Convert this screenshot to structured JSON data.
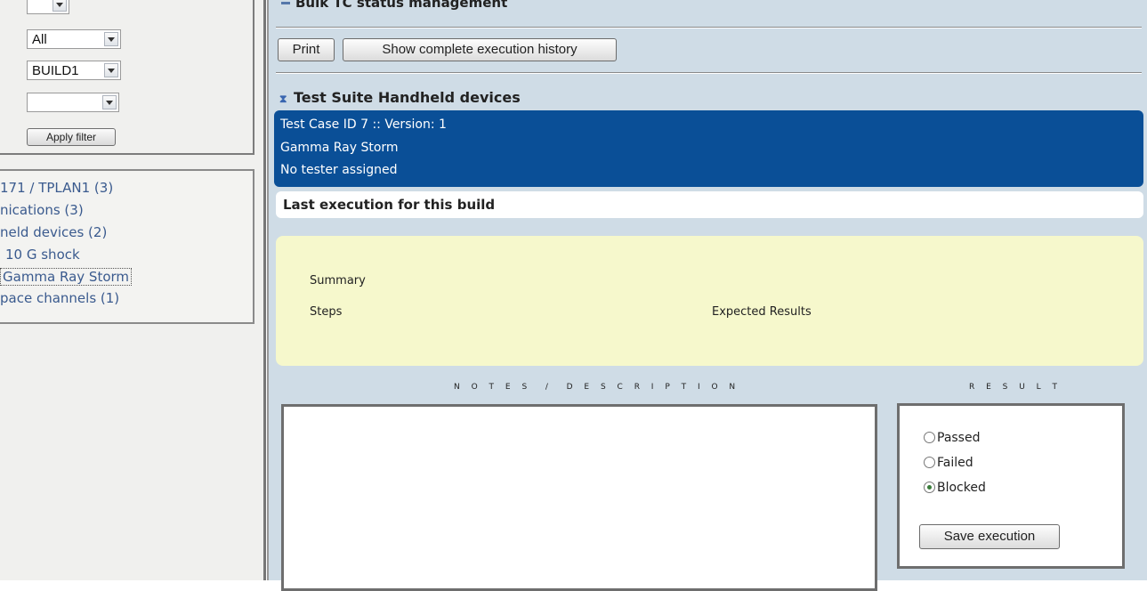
{
  "filters": {
    "select_top": "",
    "select_all": "All",
    "select_build": "BUILD1",
    "select_empty": "",
    "apply_label": "Apply filter"
  },
  "tree": {
    "items": [
      "171 / TPLAN1 (3)",
      "nications (3)",
      "neld devices (2)",
      "10 G shock",
      "Gamma Ray Storm",
      "pace channels (1)"
    ]
  },
  "main": {
    "bulk_title": "Bulk TC status management",
    "print_label": "Print",
    "history_label": "Show complete execution history",
    "suite_title": "Test Suite Handheld devices",
    "testcase": {
      "id_line": "Test Case ID 7 :: Version: 1",
      "name": "Gamma Ray Storm",
      "tester": "No tester assigned"
    },
    "last_exec_title": "Last execution for this build",
    "summary_label": "Summary",
    "steps_label": "Steps",
    "expected_label": "Expected Results",
    "notes_header": "Notes / Description",
    "result_header": "Result",
    "results": [
      "Passed",
      "Failed",
      "Blocked"
    ],
    "selected_result": "Blocked",
    "save_label": "Save execution"
  }
}
